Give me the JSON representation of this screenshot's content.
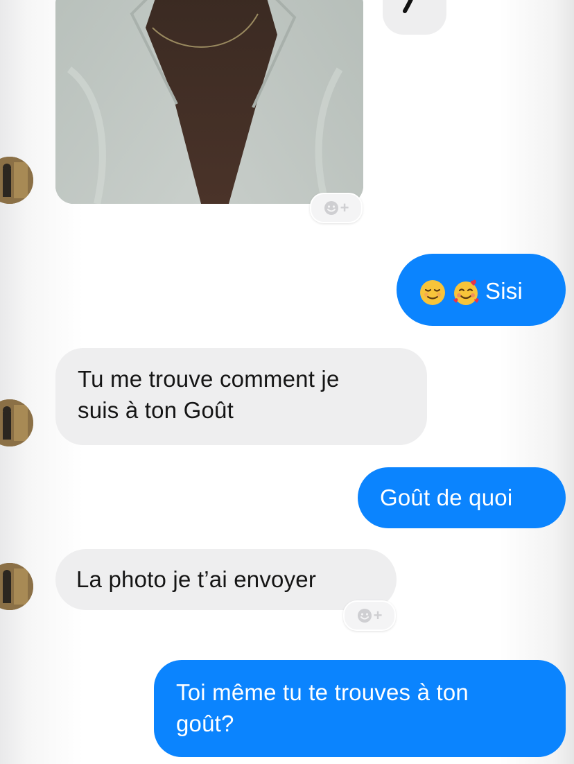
{
  "conversation": {
    "messages": [
      {
        "id": "m1",
        "direction": "incoming",
        "type": "photo"
      },
      {
        "id": "m2",
        "direction": "outgoing",
        "emoji": [
          "relieved-face",
          "smiling-face-with-hearts"
        ],
        "text": "Sisi"
      },
      {
        "id": "m3",
        "direction": "incoming",
        "lines": [
          "Tu me trouve comment je",
          "suis à ton Goût"
        ]
      },
      {
        "id": "m4",
        "direction": "outgoing",
        "text": "Goût de quoi"
      },
      {
        "id": "m5",
        "direction": "incoming",
        "text": "La photo je t’ai envoyer"
      },
      {
        "id": "m6",
        "direction": "outgoing",
        "lines": [
          "Toi même tu te trouves à ton",
          "goût?"
        ]
      }
    ],
    "reaction_button": {
      "icon": "add-reaction-icon",
      "plus": "+"
    }
  },
  "colors": {
    "outgoing_bubble": "#0b84fe",
    "incoming_bubble": "#eeeeef",
    "outgoing_text": "#ffffff",
    "incoming_text": "#151515"
  }
}
